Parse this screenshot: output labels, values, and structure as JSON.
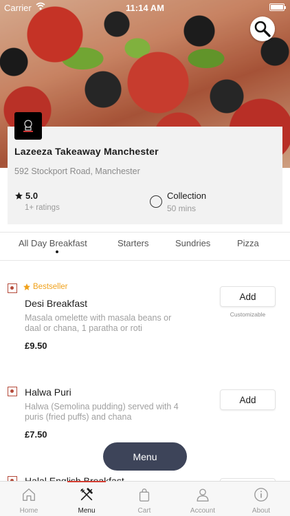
{
  "status": {
    "carrier": "Carrier",
    "time": "11:14 AM"
  },
  "restaurant": {
    "name": "Lazeeza Takeaway Manchester",
    "address": "592 Stockport Road, Manchester",
    "rating": "5.0",
    "rating_count": "1+ ratings",
    "mode_label": "Collection",
    "mode_time": "50 mins"
  },
  "tabs": [
    {
      "label": "All Day Breakfast",
      "active": true
    },
    {
      "label": "Starters"
    },
    {
      "label": "Sundries"
    },
    {
      "label": "Pizza"
    }
  ],
  "items": [
    {
      "badge": "Bestseller",
      "name": "Desi Breakfast",
      "desc_line1": "Masala omelette with masala beans or",
      "desc_line2": "daal or chana, 1 paratha or roti",
      "price": "£9.50",
      "add_label": "Add",
      "note": "Customizable"
    },
    {
      "name": "Halwa Puri",
      "desc_line1": "Halwa (Semolina pudding) served with 4",
      "desc_line2": "puris (fried puffs) and chana",
      "price": "£7.50",
      "add_label": "Add"
    },
    {
      "name": "Halal English Breakfast"
    }
  ],
  "menu_button": "Menu",
  "nav": [
    {
      "label": "Home",
      "icon": "home-icon"
    },
    {
      "label": "Menu",
      "icon": "fork-knife-icon",
      "active": true
    },
    {
      "label": "Cart",
      "icon": "shopping-bag-icon"
    },
    {
      "label": "Account",
      "icon": "person-icon"
    },
    {
      "label": "About",
      "icon": "info-icon"
    }
  ],
  "colors": {
    "accent": "#d33b2f",
    "bestseller": "#f0a11b",
    "fab": "#3d4459"
  }
}
